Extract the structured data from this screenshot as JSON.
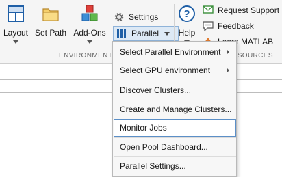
{
  "toolbar": {
    "layout_label": "Layout",
    "setpath_label": "Set Path",
    "addons_label": "Add-Ons",
    "settings_label": "Settings",
    "parallel_label": "Parallel",
    "help_label": "Help",
    "request_support_label": "Request Support",
    "feedback_label": "Feedback",
    "learn_matlab_label": "Learn MATLAB",
    "section_environment": "ENVIRONMENT",
    "section_resources": "RESOURCES"
  },
  "menu": {
    "items": [
      {
        "label": "Select Parallel Environment",
        "submenu": true
      },
      {
        "label": "Select GPU environment",
        "submenu": true
      },
      {
        "label": "Discover Clusters...",
        "submenu": false
      },
      {
        "label": "Create and Manage Clusters...",
        "submenu": false
      },
      {
        "label": "Monitor Jobs",
        "submenu": false,
        "highlighted": true
      },
      {
        "label": "Open Pool Dashboard...",
        "submenu": false
      },
      {
        "label": "Parallel Settings...",
        "submenu": false
      }
    ]
  },
  "colors": {
    "accent": "#0072bd",
    "highlight_border": "#5b8fc7",
    "menu_bg": "#f7f7f7"
  },
  "icons": [
    "layout-icon",
    "folder-icon",
    "addons-cubes-icon",
    "gear-icon",
    "parallel-icon",
    "help-icon",
    "request-support-icon",
    "feedback-icon",
    "learn-matlab-icon"
  ]
}
